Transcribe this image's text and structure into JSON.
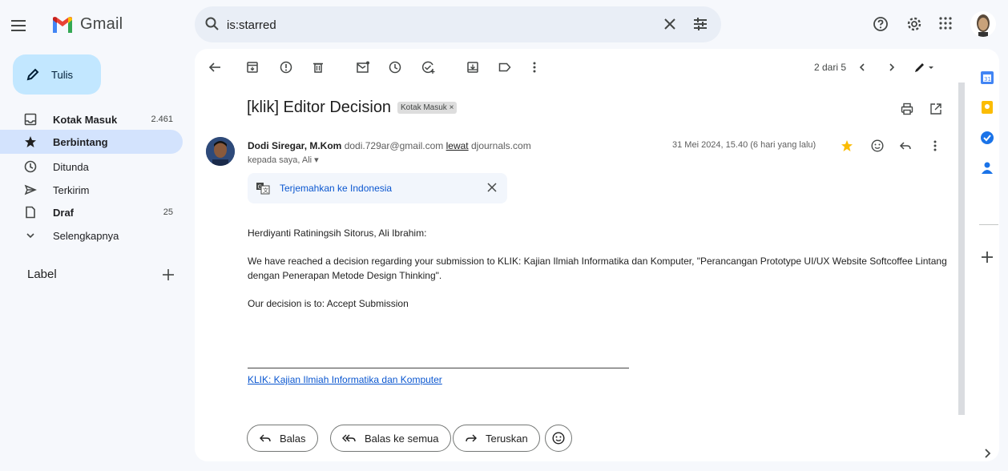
{
  "app": {
    "name": "Gmail"
  },
  "search": {
    "query": "is:starred"
  },
  "compose": {
    "label": "Tulis"
  },
  "nav": {
    "items": [
      {
        "label": "Kotak Masuk",
        "count": "2.461"
      },
      {
        "label": "Berbintang",
        "count": ""
      },
      {
        "label": "Ditunda",
        "count": ""
      },
      {
        "label": "Terkirim",
        "count": ""
      },
      {
        "label": "Draf",
        "count": "25"
      },
      {
        "label": "Selengkapnya",
        "count": ""
      }
    ],
    "labels_header": "Label"
  },
  "toolbar": {
    "pager": "2 dari 5"
  },
  "email": {
    "subject": "[klik] Editor Decision",
    "subject_badge": "Kotak Masuk ×",
    "sender_name": "Dodi Siregar, M.Kom",
    "sender_email": "dodi.729ar@gmail.com",
    "via_label": "lewat",
    "via_domain": "djournals.com",
    "to_line": "kepada saya, Ali ▾",
    "date": "31 Mei 2024, 15.40 (6 hari yang lalu)",
    "translate_label": "Terjemahkan ke Indonesia",
    "greeting": "Herdiyanti Ratiningsih Sitorus, Ali Ibrahim:",
    "paragraph1": "We have reached a decision regarding your submission to KLIK: Kajian Ilmiah Informatika dan Komputer, \"Perancangan Prototype UI/UX Website Softcoffee Lintang dengan Penerapan Metode Design Thinking\".",
    "paragraph2": "Our decision is to: Accept Submission",
    "signature_link": "KLIK: Kajian Ilmiah Informatika dan Komputer"
  },
  "reply_actions": {
    "reply": "Balas",
    "reply_all": "Balas ke semua",
    "forward": "Teruskan"
  },
  "colors": {
    "accent": "#0b57d0",
    "compose_bg": "#c2e7ff",
    "active_nav": "#d3e3fd",
    "star": "#fbbc04"
  }
}
